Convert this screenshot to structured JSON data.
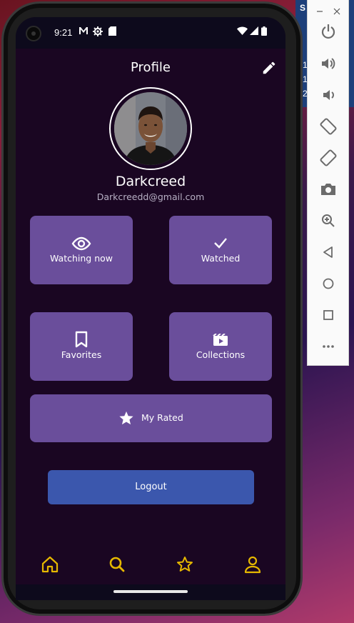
{
  "status_bar": {
    "time": "9:21"
  },
  "header": {
    "title": "Profile"
  },
  "user": {
    "name": "Darkcreed",
    "email": "Darkcreedd@gmail.com"
  },
  "tiles": {
    "watching_now": "Watching now",
    "watched": "Watched",
    "favorites": "Favorites",
    "collections": "Collections",
    "my_rated": "My Rated"
  },
  "logout_label": "Logout",
  "colors": {
    "background": "#1a0622",
    "tile": "#6a4e9b",
    "logout": "#3b57ad",
    "nav_accent": "#e6b800"
  },
  "nav": [
    "home-icon",
    "search-icon",
    "star-icon",
    "person-icon"
  ],
  "emulator_toolbar": [
    "power-icon",
    "volume-up-icon",
    "volume-down-icon",
    "rotate-left-icon",
    "rotate-right-icon",
    "camera-icon",
    "zoom-icon",
    "back-icon",
    "home-circle-icon",
    "overview-icon",
    "more-icon"
  ],
  "background_window": {
    "letters": [
      "S",
      "1",
      "1",
      "2"
    ]
  }
}
